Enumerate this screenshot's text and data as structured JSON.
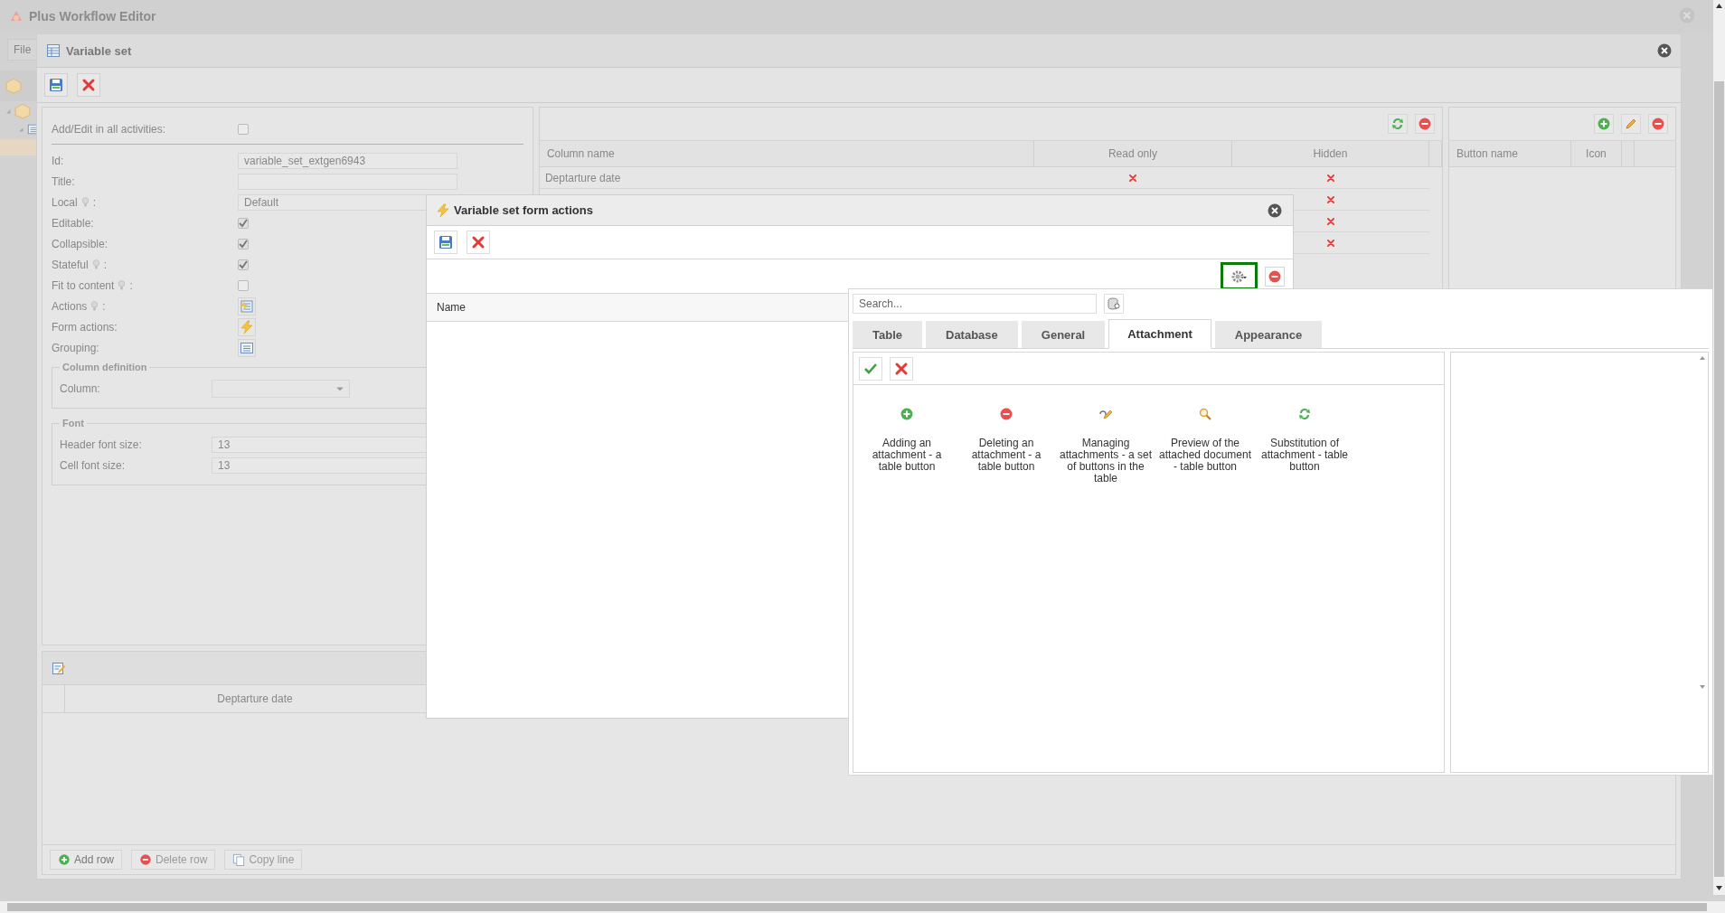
{
  "app": {
    "title": "Plus Workflow Editor",
    "menu": [
      "File"
    ]
  },
  "window": {
    "title": "Variable set",
    "form": {
      "fields": [
        {
          "kind": "checkbox",
          "label": "Add/Edit in all activities:",
          "checked": false
        },
        {
          "kind": "text",
          "label": "Id:",
          "value": "variable_set_extgen6943"
        },
        {
          "kind": "text",
          "label": "Title:"
        },
        {
          "kind": "text",
          "label": "Local",
          "hint": true,
          "after": ":",
          "value": "Default"
        },
        {
          "kind": "checkbox",
          "label": "Editable:",
          "checked": true
        },
        {
          "kind": "checkbox",
          "label": "Collapsible:",
          "checked": true
        },
        {
          "kind": "checkbox",
          "label": "Stateful",
          "hint": true,
          "after": ":",
          "checked": true
        },
        {
          "kind": "checkbox",
          "label": "Fit to content",
          "hint": true,
          "after": ":",
          "checked": false
        },
        {
          "kind": "button",
          "label": "Actions",
          "hint": true,
          "after": ":"
        },
        {
          "kind": "button",
          "label": "Form actions:"
        },
        {
          "kind": "button",
          "label": "Grouping:"
        }
      ],
      "column_definition": {
        "legend": "Column definition",
        "label": "Column:"
      },
      "font": {
        "legend": "Font",
        "fields": [
          {
            "label": "Header font size:",
            "value": "13"
          },
          {
            "label": "Cell font size:",
            "value": "13"
          }
        ]
      }
    },
    "columns_grid": {
      "columns": [
        "Column name",
        "Read only",
        "Hidden"
      ],
      "rows": [
        {
          "name": "Deptarture date",
          "read_only": true,
          "hidden": true
        },
        {
          "hidden": true
        },
        {
          "hidden": true
        },
        {
          "hidden": true
        }
      ]
    },
    "buttons_grid": {
      "columns": [
        "Button name",
        "Icon"
      ]
    },
    "bottom": {
      "column": "Deptarture date",
      "buttons": [
        {
          "label": "Add row",
          "disabled": false
        },
        {
          "label": "Delete row",
          "disabled": true
        },
        {
          "label": "Copy line",
          "disabled": true
        }
      ]
    }
  },
  "popup": {
    "title": "Variable set form actions",
    "column": "Name"
  },
  "picker": {
    "placeholder": "Search...",
    "tabs": [
      {
        "label": "Table",
        "selected": false
      },
      {
        "label": "Database",
        "selected": false
      },
      {
        "label": "General",
        "selected": false
      },
      {
        "label": "Attachment",
        "selected": true
      },
      {
        "label": "Appearance",
        "selected": false
      }
    ],
    "items": [
      {
        "label": "Adding an attachment - a table button"
      },
      {
        "label": "Deleting an attachment - a table button"
      },
      {
        "label": "Managing attachments - a set of buttons in the table"
      },
      {
        "label": "Preview of the attached document - table button"
      },
      {
        "label": "Substitution of attachment - table button"
      }
    ]
  }
}
